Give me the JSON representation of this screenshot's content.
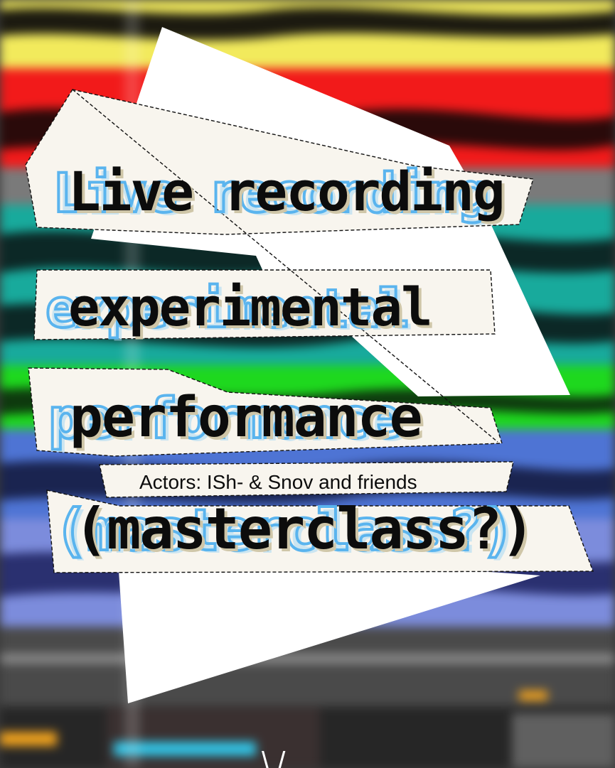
{
  "poster": {
    "line1": "Live recording",
    "line2": "experimental",
    "line3": "performance",
    "actors": "Actors: ISh- & Snov and friends",
    "line4": "(masterclass?)",
    "bottom_mark": "\\ /"
  },
  "colors": {
    "paper": "#f8f5ee",
    "white": "#ffffff",
    "ink": "#0c0c0c",
    "glitch_blue": "#5ab4ee",
    "glitch_shade": "#a8d8f4",
    "shadow_tint": "#cfc6a8",
    "band_yellow": "#f2ea5c",
    "band_red": "#f21a1a",
    "band_teal": "#18aa9c",
    "band_green": "#1ed81e",
    "band_blue": "#4e74d4",
    "band_periwinkle": "#7c8cdc",
    "band_gray": "#7a7a7a",
    "accent_orange": "#f0a21e",
    "accent_cyan": "#32c4e6"
  }
}
